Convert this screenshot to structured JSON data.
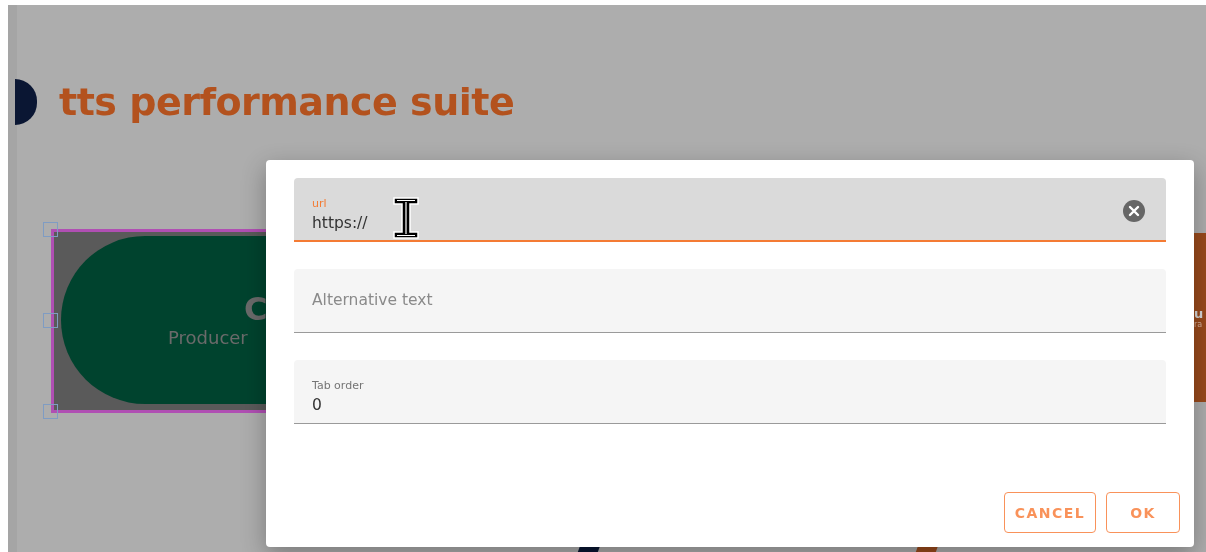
{
  "page": {
    "title": "tts performance suite"
  },
  "canvas_items": [
    {
      "kind": "pill",
      "selected": true,
      "heading": "C",
      "subtitle": "Producer"
    },
    {
      "kind": "block",
      "selected": false,
      "heading": "u",
      "subtitle": "ra"
    }
  ],
  "dialog": {
    "fields": [
      {
        "label": "url",
        "value": "https://",
        "focused": true,
        "clearable": true
      },
      {
        "placeholder": "Alternative text",
        "focused": false,
        "clearable": false
      },
      {
        "label": "Tab order",
        "value": "0",
        "focused": false,
        "clearable": false
      }
    ],
    "buttons": [
      "CANCEL",
      "OK"
    ]
  }
}
